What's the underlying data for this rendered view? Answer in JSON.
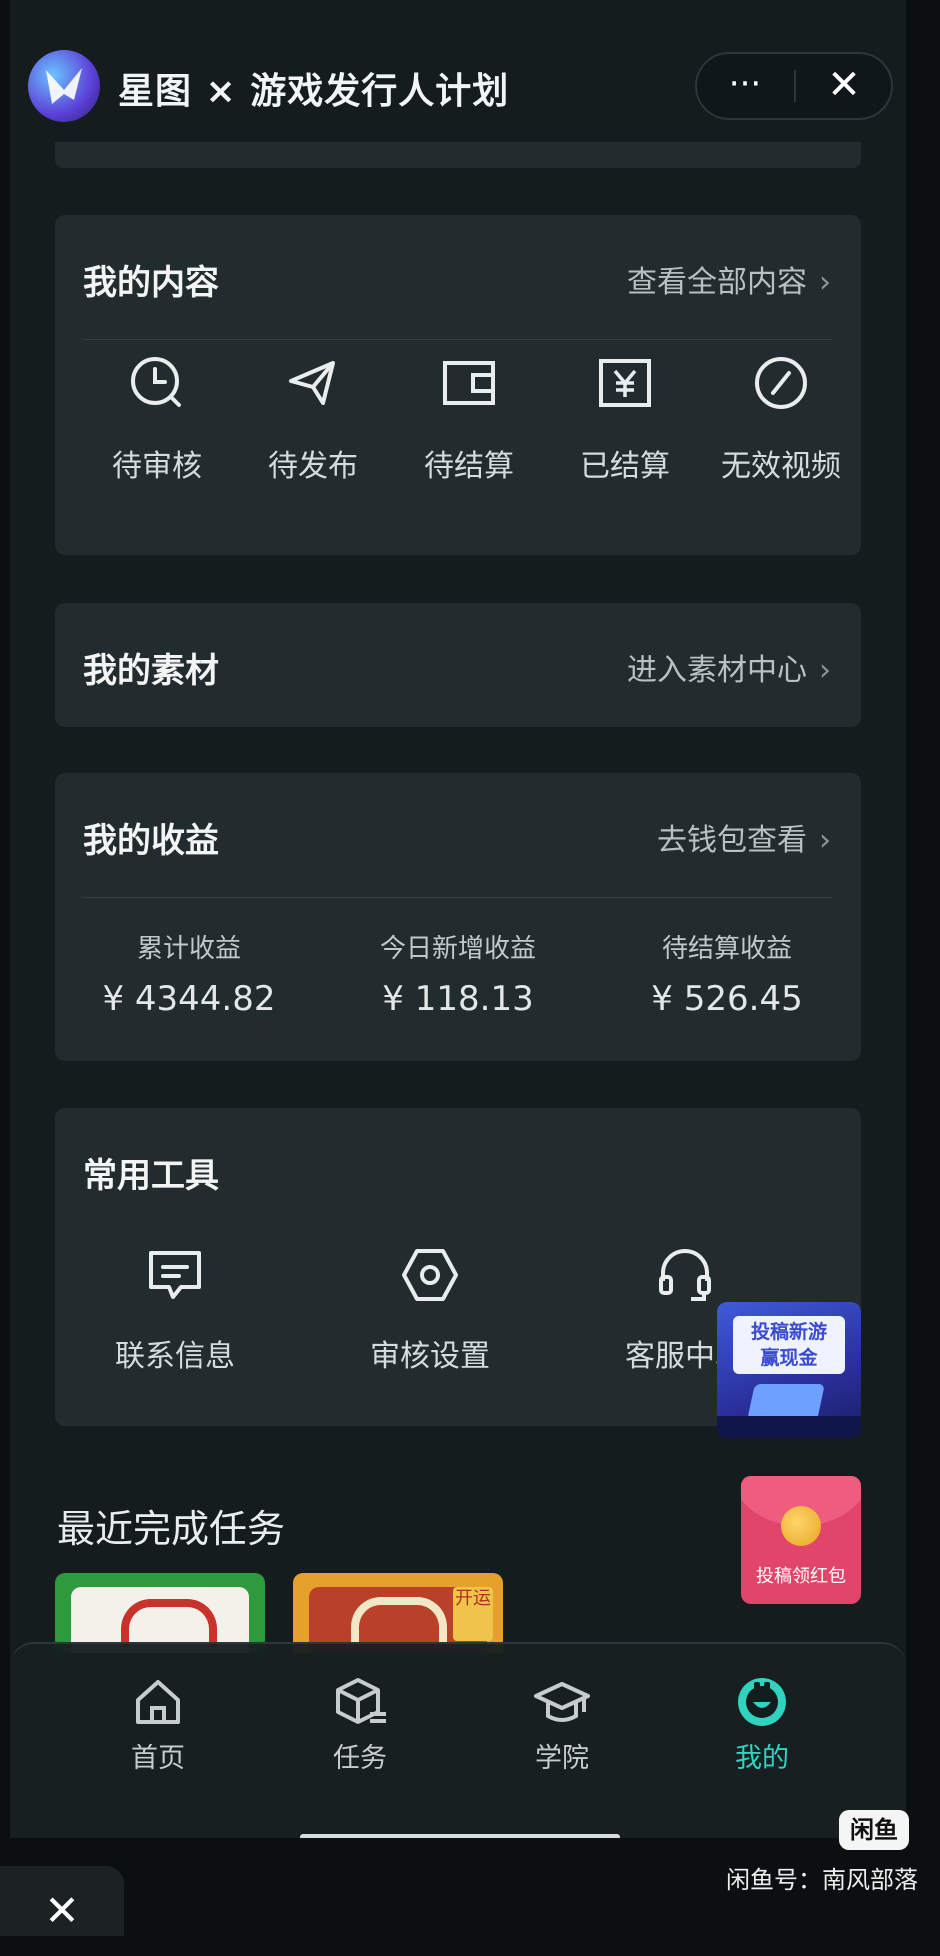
{
  "header": {
    "title": "星图 × 游戏发行人计划",
    "more_label": "···",
    "close_label": "✕"
  },
  "my_content": {
    "title": "我的内容",
    "link": "查看全部内容",
    "items": [
      {
        "label": "待审核",
        "icon": "clock-icon"
      },
      {
        "label": "待发布",
        "icon": "send-icon"
      },
      {
        "label": "待结算",
        "icon": "wallet-icon"
      },
      {
        "label": "已结算",
        "icon": "yen-icon"
      },
      {
        "label": "无效视频",
        "icon": "invalid-icon"
      }
    ]
  },
  "my_material": {
    "title": "我的素材",
    "link": "进入素材中心"
  },
  "my_earnings": {
    "title": "我的收益",
    "link": "去钱包查看",
    "stats": [
      {
        "label": "累计收益",
        "value": "¥ 4344.82"
      },
      {
        "label": "今日新增收益",
        "value": "¥ 118.13"
      },
      {
        "label": "待结算收益",
        "value": "¥ 526.45"
      }
    ]
  },
  "tools": {
    "title": "常用工具",
    "items": [
      {
        "label": "联系信息",
        "icon": "message-icon"
      },
      {
        "label": "审核设置",
        "icon": "settings-icon"
      },
      {
        "label": "客服中心",
        "icon": "headset-icon"
      }
    ]
  },
  "promo_new_game": {
    "text": "投稿新游\n赢现金"
  },
  "promo_red_packet": {
    "text": "投稿领红包"
  },
  "recent_tasks": {
    "title": "最近完成任务",
    "thumb2_tag": "开运"
  },
  "tabbar": {
    "items": [
      {
        "label": "首页",
        "icon": "home-icon",
        "active": false
      },
      {
        "label": "任务",
        "icon": "task-box-icon",
        "active": false
      },
      {
        "label": "学院",
        "icon": "graduation-cap-icon",
        "active": false
      },
      {
        "label": "我的",
        "icon": "profile-icon",
        "active": true
      }
    ]
  },
  "watermark": {
    "logo": "闲鱼",
    "text": "闲鱼号：南风部落"
  },
  "floating_close": "✕",
  "colors": {
    "accent": "#2fd3c0",
    "card": "#222b2d",
    "background": "#151c1e"
  }
}
